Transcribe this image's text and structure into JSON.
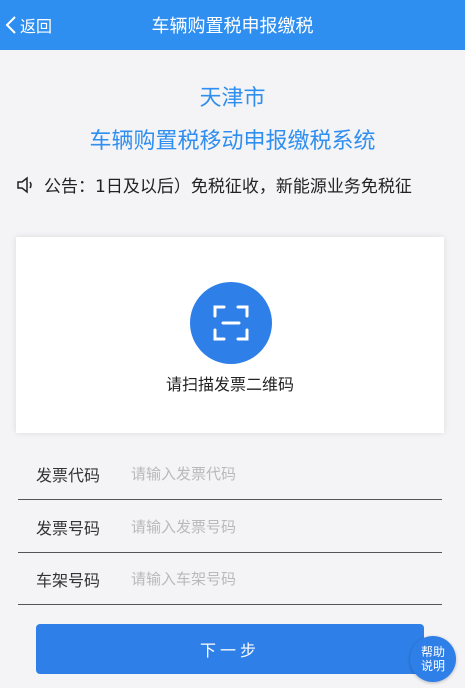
{
  "nav": {
    "back_label": "返回",
    "title": "车辆购置税申报缴税"
  },
  "header": {
    "city": "天津市",
    "system_title": "车辆购置税移动申报缴税系统"
  },
  "notice": {
    "text": "公告：1日及以后）免税征收，新能源业务免税征"
  },
  "scan": {
    "label": "请扫描发票二维码"
  },
  "form": {
    "fields": [
      {
        "label": "发票代码",
        "placeholder": "请输入发票代码",
        "value": ""
      },
      {
        "label": "发票号码",
        "placeholder": "请输入发票号码",
        "value": ""
      },
      {
        "label": "车架号码",
        "placeholder": "请输入车架号码",
        "value": ""
      }
    ]
  },
  "actions": {
    "next_label": "下一步",
    "help_line1": "帮助",
    "help_line2": "说明"
  },
  "colors": {
    "primary": "#2f8ff0",
    "button": "#2f7fe8",
    "background": "#f4f4f6"
  }
}
